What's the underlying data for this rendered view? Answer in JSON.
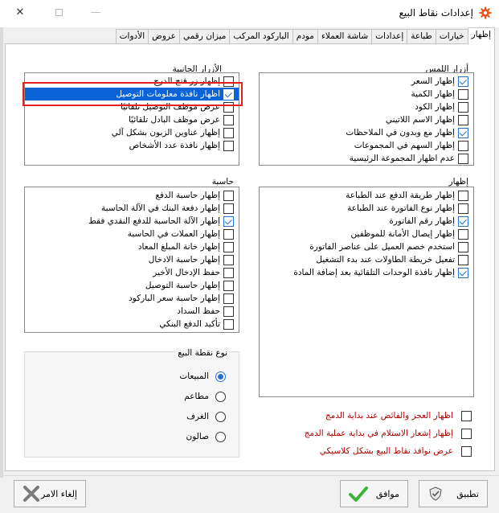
{
  "window": {
    "title": "إعدادات نقاط البيع",
    "close_glyph": "✕",
    "min_glyph": "—",
    "icon": "gear-icon",
    "accent_color": "#e8541c"
  },
  "tabs": [
    {
      "label": "إظهار",
      "active": true
    },
    {
      "label": "خيارات"
    },
    {
      "label": "طباعة"
    },
    {
      "label": "إعدادات"
    },
    {
      "label": "شاشة العملاء"
    },
    {
      "label": "مودم"
    },
    {
      "label": "الباركود المركب"
    },
    {
      "label": "ميزان رقمي"
    },
    {
      "label": "عروض"
    },
    {
      "label": "الأدوات"
    }
  ],
  "touch_buttons": {
    "label": "أزرار اللمس",
    "items": [
      {
        "label": "إظهار السعر",
        "checked": true
      },
      {
        "label": "إظهار الكمية",
        "checked": false
      },
      {
        "label": "إظهار الكود",
        "checked": false
      },
      {
        "label": "إظهار الاسم اللاتيني",
        "checked": false
      },
      {
        "label": "إظهار مع وبدون في الملاحظات",
        "checked": true
      },
      {
        "label": "إظهار السهم في المجموعات",
        "checked": false
      },
      {
        "label": "عدم اظهار المجموعة الرئيسية",
        "checked": false
      }
    ]
  },
  "side_buttons": {
    "label": "الأزرار الجانبية",
    "items": [
      {
        "label": "إظهار زر فتح الدرج",
        "checked": false
      },
      {
        "label": "اظهار نافذة معلومات التوصيل",
        "checked": true,
        "selected": true
      },
      {
        "label": "عرض موظف التوصيل تلقائيًا",
        "checked": false
      },
      {
        "label": "عرض موظف البادل تلقائيًا",
        "checked": false
      },
      {
        "label": "إظهار عناوين الزبون بشكل آلي",
        "checked": false
      },
      {
        "label": "إظهار نافذة عدد الأشخاص",
        "checked": false
      }
    ]
  },
  "display": {
    "label": "إظهار",
    "items": [
      {
        "label": "إظهار طريقة الدفع عند الطباعة",
        "checked": false
      },
      {
        "label": "إظهار نوع الفاتورة عند الطباعة",
        "checked": false
      },
      {
        "label": "إظهار رقم الفاتورة",
        "checked": true
      },
      {
        "label": "إظهار إيصال الأمانة للموظفين",
        "checked": false
      },
      {
        "label": "استخدم خصم العميل على عناصر الفاتورة",
        "checked": false
      },
      {
        "label": "تفعيل خريطة الطاولات عند بدء التشغيل",
        "checked": false
      },
      {
        "label": "إظهار نافذة الوحدات التلقائية بعد إضافة المادة",
        "checked": true
      }
    ]
  },
  "calculator": {
    "label": "حاسبة",
    "items": [
      {
        "label": "إظهار حاسبة الدفع",
        "checked": false
      },
      {
        "label": "إظهار دفعة البنك في الآلة الحاسبة",
        "checked": false
      },
      {
        "label": "إظهار الآلة الحاسبة للدفع النقدي فقط",
        "checked": true
      },
      {
        "label": "إظهار العملات في الحاسبة",
        "checked": false
      },
      {
        "label": "إظهار خانة المبلغ المعاد",
        "checked": false
      },
      {
        "label": "إظهار حاسبة الادخال",
        "checked": false
      },
      {
        "label": "حفظ الإدخال الأخير",
        "checked": false
      },
      {
        "label": "إظهار حاسبة التوصيل",
        "checked": false
      },
      {
        "label": "إظهار حاسبة سعر الباركود",
        "checked": false
      },
      {
        "label": "حفظ السداد",
        "checked": false
      },
      {
        "label": "تأكيد الدفع البنكي",
        "checked": false
      }
    ]
  },
  "pos_type": {
    "label": "نوع نقطة البيع",
    "options": [
      {
        "label": "المبيعات",
        "selected": true
      },
      {
        "label": "مطاعم",
        "selected": false
      },
      {
        "label": "الغرف",
        "selected": false
      },
      {
        "label": "صالون",
        "selected": false
      }
    ]
  },
  "footer_options": [
    {
      "label": "اظهار العجز والفائض عند بداية الدمج",
      "checked": false
    },
    {
      "label": "إظهار إشعار الاستلام في بداية عملية الدمج",
      "checked": false
    },
    {
      "label": "عرض نوافذ نقاط البيع بشكل كلاسيكي",
      "checked": false
    }
  ],
  "buttons": {
    "apply": "تطبيق",
    "ok": "موافق",
    "cancel": "إلغاء الامر"
  },
  "colors": {
    "selection": "#0a64d8",
    "highlight_frame": "#e0211f",
    "danger_text": "#b00000",
    "check": "#2a6fd0",
    "ok_icon": "#3cb43c",
    "cancel_icon": "#7a7a7a"
  }
}
